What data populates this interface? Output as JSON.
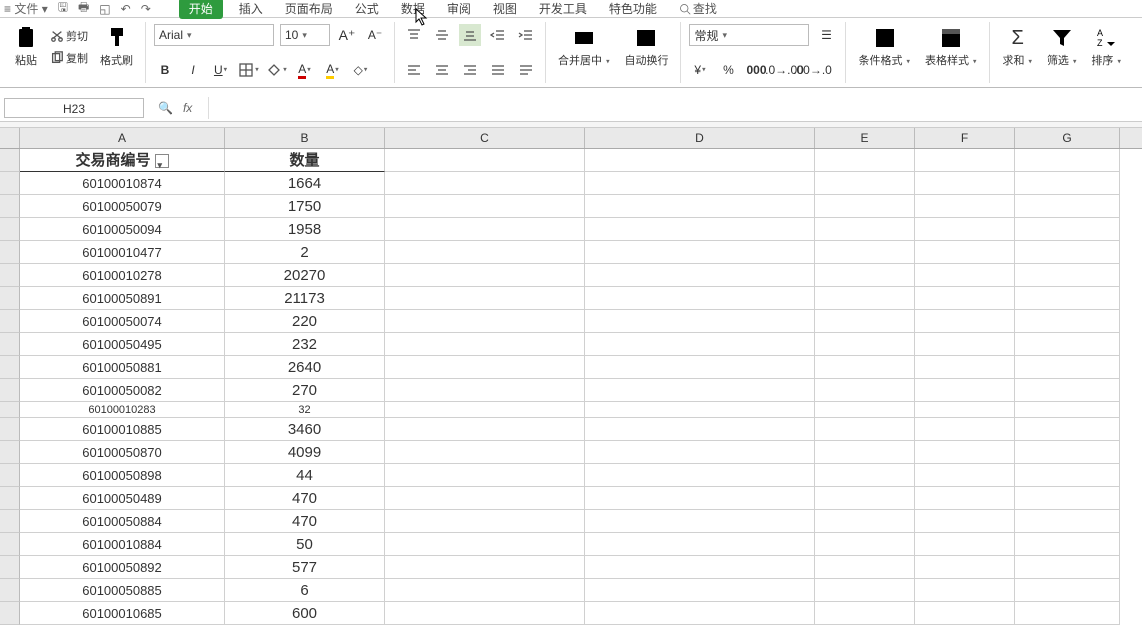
{
  "menubar": {
    "file": "文件",
    "tabs": [
      "开始",
      "插入",
      "页面布局",
      "公式",
      "数据",
      "审阅",
      "视图",
      "开发工具",
      "特色功能"
    ],
    "search": "查找"
  },
  "ribbon": {
    "clipboard": {
      "paste": "粘贴",
      "cut": "剪切",
      "copy": "复制",
      "format_painter": "格式刷"
    },
    "font": {
      "name": "Arial",
      "size": "10"
    },
    "align": {},
    "merge": {
      "merge": "合并居中",
      "wrap": "自动换行"
    },
    "number": {
      "format": "常规"
    },
    "styles": {
      "cond": "条件格式",
      "table": "表格样式"
    },
    "editing": {
      "sum": "求和",
      "filter": "筛选",
      "sort": "排序"
    }
  },
  "namebox": "H23",
  "fx": "fx",
  "columns": [
    "A",
    "B",
    "C",
    "D",
    "E",
    "F",
    "G"
  ],
  "headers": {
    "A": "交易商编号",
    "B": "数量"
  },
  "rows": [
    {
      "r": "",
      "a": "60100010874",
      "b": "1664"
    },
    {
      "r": "",
      "a": "60100050079",
      "b": "1750"
    },
    {
      "r": "",
      "a": "60100050094",
      "b": "1958"
    },
    {
      "r": "",
      "a": "60100010477",
      "b": "2"
    },
    {
      "r": "",
      "a": "60100010278",
      "b": "20270"
    },
    {
      "r": "",
      "a": "60100050891",
      "b": "21173"
    },
    {
      "r": "",
      "a": "60100050074",
      "b": "220"
    },
    {
      "r": "",
      "a": "60100050495",
      "b": "232"
    },
    {
      "r": "",
      "a": "60100050881",
      "b": "2640"
    },
    {
      "r": "",
      "a": "60100050082",
      "b": "270"
    },
    {
      "r": "",
      "a": "60100010283",
      "b": "32",
      "small": true
    },
    {
      "r": "",
      "a": "60100010885",
      "b": "3460"
    },
    {
      "r": "",
      "a": "60100050870",
      "b": "4099"
    },
    {
      "r": "",
      "a": "60100050898",
      "b": "44"
    },
    {
      "r": "",
      "a": "60100050489",
      "b": "470"
    },
    {
      "r": "",
      "a": "60100050884",
      "b": "470"
    },
    {
      "r": "",
      "a": "60100010884",
      "b": "50"
    },
    {
      "r": "",
      "a": "60100050892",
      "b": "577"
    },
    {
      "r": "",
      "a": "60100050885",
      "b": "6"
    },
    {
      "r": "",
      "a": "60100010685",
      "b": "600"
    }
  ]
}
